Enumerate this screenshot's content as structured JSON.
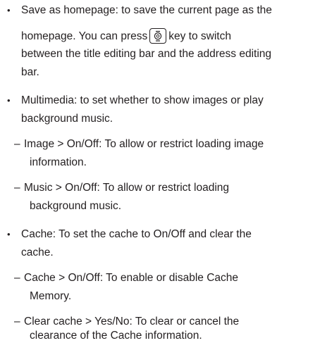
{
  "sections": [
    {
      "lines": [
        "Save as homepage: to save the current page as the",
        "homepage. You can press",
        "key to switch",
        "between the title editing bar and the address editing",
        "bar."
      ],
      "key_icon": "navigation-key-icon"
    },
    {
      "lines": [
        "Multimedia: to set whether to show images or play",
        "background music."
      ],
      "subitems": [
        {
          "lines": [
            "Image > On/Off: To allow or restrict loading image",
            "information."
          ]
        },
        {
          "lines": [
            "Music > On/Off: To allow or restrict loading",
            "background music."
          ]
        }
      ]
    },
    {
      "lines": [
        "Cache: To set the cache to On/Off and clear the",
        "cache."
      ],
      "subitems": [
        {
          "lines": [
            "Cache >  On/Off: To enable or disable Cache",
            "Memory."
          ]
        },
        {
          "lines": [
            "Clear cache > Yes/No: To clear or cancel the",
            "clearance of the Cache information."
          ]
        }
      ]
    }
  ]
}
